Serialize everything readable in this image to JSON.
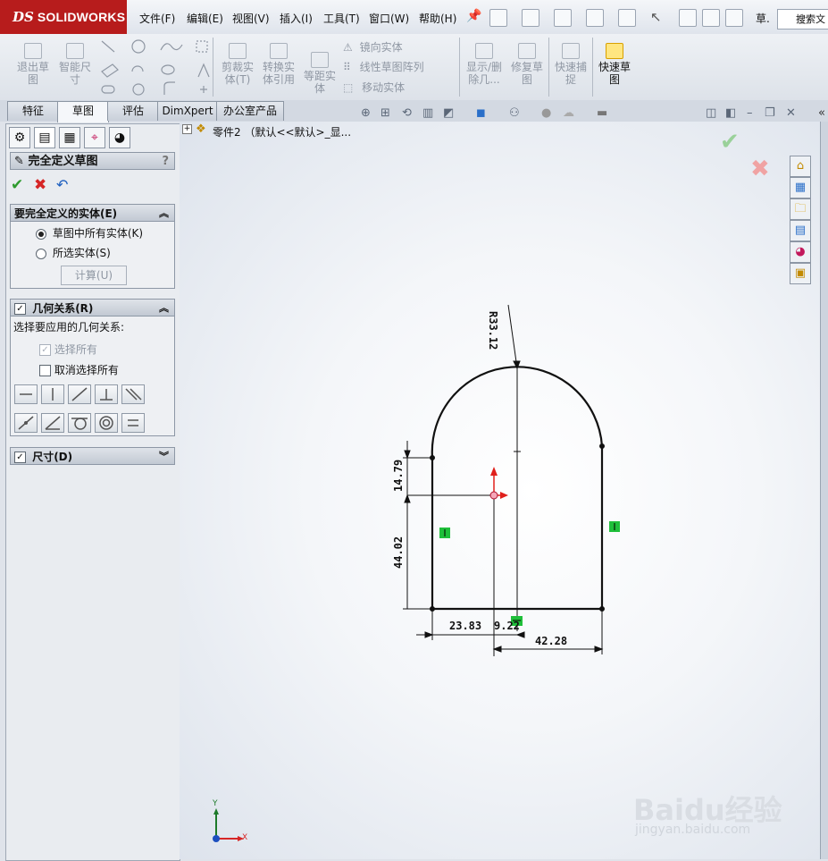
{
  "app": {
    "logo_ds": "DS",
    "logo_name": "SOLIDWORKS"
  },
  "menu": [
    "文件(F)",
    "编辑(E)",
    "视图(V)",
    "插入(I)",
    "工具(T)",
    "窗口(W)",
    "帮助(H)"
  ],
  "menu_extra": "草.",
  "search": {
    "label": "搜索文"
  },
  "commands": {
    "exit_sketch": [
      "退出草",
      "图"
    ],
    "smart_dim": [
      "智能尺",
      "寸"
    ],
    "trim": [
      "剪裁实",
      "体(T)"
    ],
    "convert": [
      "转换实",
      "体引用"
    ],
    "offset": [
      "等距实",
      "体"
    ],
    "mirror": "镜向实体",
    "linear_pattern": "线性草图阵列",
    "move": "移动实体",
    "show_delete": [
      "显示/删",
      "除几..."
    ],
    "repair": [
      "修复草",
      "图"
    ],
    "quick_snap": [
      "快速捕",
      "捉"
    ],
    "rapid_sketch": [
      "快速草",
      "图"
    ]
  },
  "tabs": [
    "特征",
    "草图",
    "评估",
    "DimXpert",
    "办公室产品"
  ],
  "active_tab": "草图",
  "tree": {
    "root": "零件2 （默认<<默认>_显..."
  },
  "panel": {
    "title": "完全定义草图",
    "help": "?",
    "group1": {
      "title": "要完全定义的实体(E)",
      "options": [
        "草图中所有实体(K)",
        "所选实体(S)"
      ],
      "selected": 0,
      "button": "计算(U)"
    },
    "group2": {
      "title": "几何关系(R)",
      "prompt": "选择要应用的几何关系:",
      "select_all": "选择所有",
      "deselect_all": "取消选择所有"
    },
    "group3": {
      "title": "尺寸(D)"
    }
  },
  "sketch": {
    "dims": {
      "radius": "R33.12",
      "upper_height": "14.79",
      "lower_height": "44.02",
      "left_offset": "23.83",
      "small": "9.22",
      "right_width": "42.28"
    }
  },
  "triad": {
    "x": "X",
    "y": "Y"
  },
  "watermark": {
    "brand": "Baidu经验",
    "url": "jingyan.baidu.com"
  },
  "colors": {
    "accent_red": "#b71c1c",
    "confirm_green": "#2e9b2e",
    "cancel_red": "#d62626",
    "relation_green": "#1fbf3a"
  }
}
